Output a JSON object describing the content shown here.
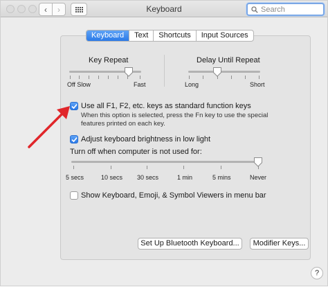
{
  "window": {
    "title": "Keyboard"
  },
  "search": {
    "placeholder": "Search"
  },
  "tabs": [
    {
      "label": "Keyboard",
      "active": true
    },
    {
      "label": "Text",
      "active": false
    },
    {
      "label": "Shortcuts",
      "active": false
    },
    {
      "label": "Input Sources",
      "active": false
    }
  ],
  "key_repeat": {
    "label": "Key Repeat",
    "min_label": "Off Slow",
    "max_label": "Fast",
    "value_fraction": 0.85
  },
  "delay_until_repeat": {
    "label": "Delay Until Repeat",
    "min_label": "Long",
    "max_label": "Short",
    "value_fraction": 0.4
  },
  "function_keys": {
    "label": "Use all F1, F2, etc. keys as standard function keys",
    "checked": true,
    "description_line1": "When this option is selected, press the Fn key to use the special",
    "description_line2": "features printed on each key."
  },
  "brightness": {
    "label": "Adjust keyboard brightness in low light",
    "checked": true
  },
  "turn_off": {
    "label": "Turn off when computer is not used for:",
    "ticks": [
      "5 secs",
      "10 secs",
      "30 secs",
      "1 min",
      "5 mins",
      "Never"
    ],
    "selected": "Never"
  },
  "viewers": {
    "label": "Show Keyboard, Emoji, & Symbol Viewers in menu bar",
    "checked": false
  },
  "buttons": {
    "bluetooth": "Set Up Bluetooth Keyboard...",
    "modifier": "Modifier Keys..."
  },
  "help": {
    "label": "?"
  },
  "colors": {
    "accent": "#2b7ae8",
    "annotation_arrow": "#e0262a"
  }
}
